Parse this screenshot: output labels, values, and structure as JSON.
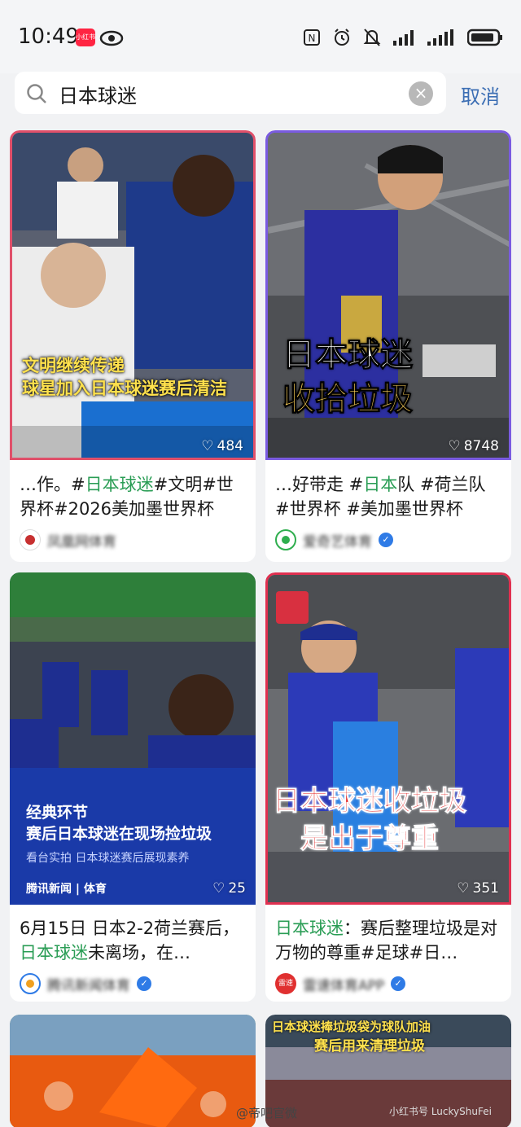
{
  "status_bar": {
    "time": "10:49",
    "app_badge": "小红书",
    "icons": [
      "eye-icon",
      "nfc-icon",
      "alarm-icon",
      "mute-icon",
      "signal-icon",
      "wifi-speed-icon",
      "battery-icon"
    ]
  },
  "search": {
    "query": "日本球迷",
    "cancel_label": "取消"
  },
  "cards": [
    {
      "overlay_line1": "文明继续传递",
      "overlay_line2": "球星加入日本球迷赛后清洁",
      "likes": "484",
      "title_pre": "…作。#",
      "title_hl": "日本球迷",
      "title_post": "#文明#世界杯#2026美加墨世界杯",
      "author": "凤凰网体育",
      "verified": false,
      "border_color": "#e0506a"
    },
    {
      "overlay_line1": "日本球迷",
      "overlay_line2": "收拾垃圾",
      "likes": "8748",
      "title_pre": "…好带走 #",
      "title_hl": "日本",
      "title_post": "队 #荷兰队 #世界杯 #美加墨世界杯",
      "author": "爱奇艺体育",
      "verified": true,
      "border_color": "#7a5be0"
    },
    {
      "overlay_line1": "经典环节",
      "overlay_line2": "赛后日本球迷在现场捡垃圾",
      "overlay_line3": "看台实拍 日本球迷赛后展现素养",
      "overlay_brand": "腾讯新闻 | 体育",
      "likes": "25",
      "title_pre": "6月15日 日本2-2荷兰赛后，",
      "title_hl": "日本球迷",
      "title_post": "未离场，在…",
      "author": "腾讯新闻体育",
      "verified": true,
      "border_color": "#ffffff"
    },
    {
      "overlay_line1": "日本球迷收垃圾",
      "overlay_line2": "是出于尊重",
      "likes": "351",
      "title_pre": "",
      "title_hl": "日本球迷",
      "title_post": "：赛后整理垃圾是对万物的尊重#足球#日…",
      "author": "雷速体育APP",
      "author_avatar_label": "雷速",
      "verified": true,
      "border_color": "#e03050"
    },
    {
      "title_pre": "",
      "title_hl": "",
      "title_post": "",
      "author": "",
      "verified": false
    },
    {
      "overlay_line1": "日本球迷捧垃圾袋为球队加油",
      "overlay_line2": "赛后用来清理垃圾",
      "title_pre": "",
      "title_hl": "",
      "title_post": "",
      "author": "",
      "verified": false
    }
  ],
  "footer": {
    "watermark": "@帝吧官微",
    "watermark_small": "小红书号 LuckyShuFei"
  },
  "colors": {
    "highlight": "#2a9d55",
    "cancel": "#3d6fb4",
    "app_red": "#ff2442",
    "verified_blue": "#2f7be6"
  }
}
